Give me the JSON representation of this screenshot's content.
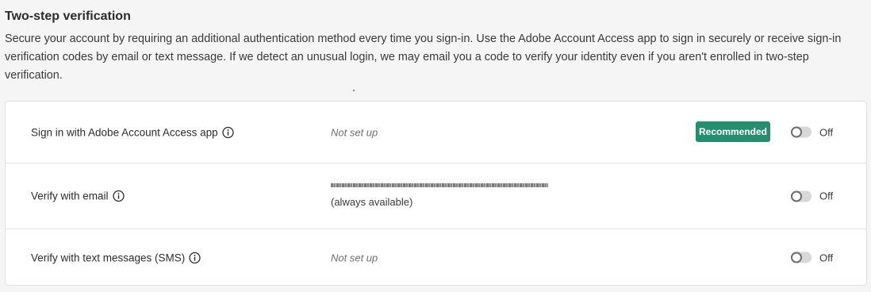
{
  "section": {
    "title": "Two-step verification",
    "description": "Secure your account by requiring an additional authentication method every time you sign-in. Use the Adobe Account Access app to sign in securely or receive sign-in verification codes by email or text message. If we detect an unusual login, we may email you a code to verify your identity even if you aren't enrolled in two-step verification."
  },
  "methods": [
    {
      "label": "Sign in with Adobe Account Access app",
      "status": "Not set up",
      "badge": "Recommended",
      "toggle_state": "Off",
      "icon": "info-icon"
    },
    {
      "label": "Verify with email",
      "email_note": "(always available)",
      "toggle_state": "Off",
      "icon": "info-icon"
    },
    {
      "label": "Verify with text messages (SMS)",
      "status": "Not set up",
      "toggle_state": "Off",
      "icon": "info-icon"
    }
  ],
  "colors": {
    "badge_bg": "#268e6c",
    "toggle_track": "#d8d8d8",
    "card_bg": "#ffffff",
    "page_bg": "#f5f5f5"
  }
}
